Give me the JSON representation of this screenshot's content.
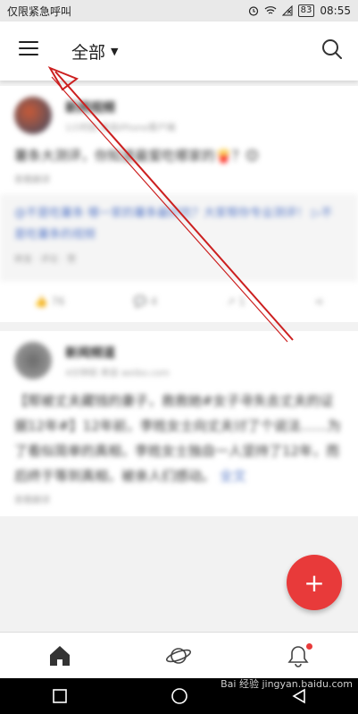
{
  "status": {
    "left_text": "仅限紧急呼叫",
    "battery": "83",
    "time": "08:55"
  },
  "header": {
    "title": "全部"
  },
  "feed": {
    "card1": {
      "name": "新闻视频",
      "sub": "1小时前 来自iPhone客户端",
      "text": "薯条大测评，你知道最爱吃哪家的🍟？😊",
      "meta": "查看翻译",
      "quote_text": "@不是吃薯条 哪一家的薯条最好吃？大家帮你专业测评！ ▷不是吃薯条的视频",
      "quote_meta": "转发 · 评论 · 赞",
      "actions": {
        "repost": "76",
        "comment": "4",
        "like": "1"
      }
    },
    "card2": {
      "name": "新闻频道",
      "sub": "4分钟前 来自 weibo.com",
      "text": "【帮被丈夫藏钱的妻子，救救她#女子寻失去丈夫的证据12年#】12年前，李姓女士向丈夫讨了个说法……为了看似简单的真相，李姓女士独自一人坚持了12年，而后终于等到真相，被亲人们感动。",
      "link": "全文",
      "meta": "查看翻译"
    }
  },
  "fab": {
    "label": "+"
  },
  "nav": {
    "items": [
      "home-icon",
      "explore-planet-icon",
      "notification-bell-icon"
    ]
  },
  "watermark": {
    "text": "Bai 经验 jingyan.baidu.com"
  },
  "colors": {
    "accent": "#e83a3a",
    "link": "#5b7cc9",
    "arrow": "#cc1f1f"
  }
}
